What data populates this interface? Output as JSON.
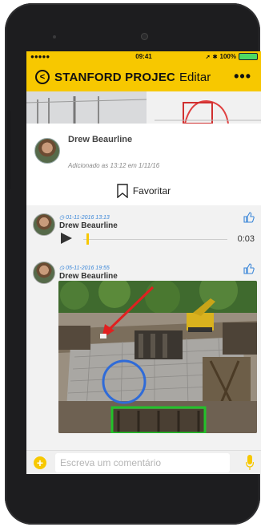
{
  "status_bar": {
    "carrier": "●●●●● ",
    "time": "09:41",
    "battery_text": "100%"
  },
  "header": {
    "title": "STANFORD PROJEC",
    "edit_label": "Editar",
    "more_label": "•••"
  },
  "post": {
    "author": "Drew Beaurline",
    "meta": "Adicionado as 13:12 em 1/11/16",
    "favorite_label": "Favoritar"
  },
  "comments": [
    {
      "date": "01-11-2016 13:13",
      "author": "Drew Beaurline",
      "type": "audio",
      "duration": "0:03"
    },
    {
      "date": "05-11-2016 19:55",
      "author": "Drew Beaurline",
      "type": "photo"
    }
  ],
  "composer": {
    "placeholder": "Escreva um comentário"
  },
  "colors": {
    "accent": "#f7c800",
    "link": "#3a86d8"
  }
}
